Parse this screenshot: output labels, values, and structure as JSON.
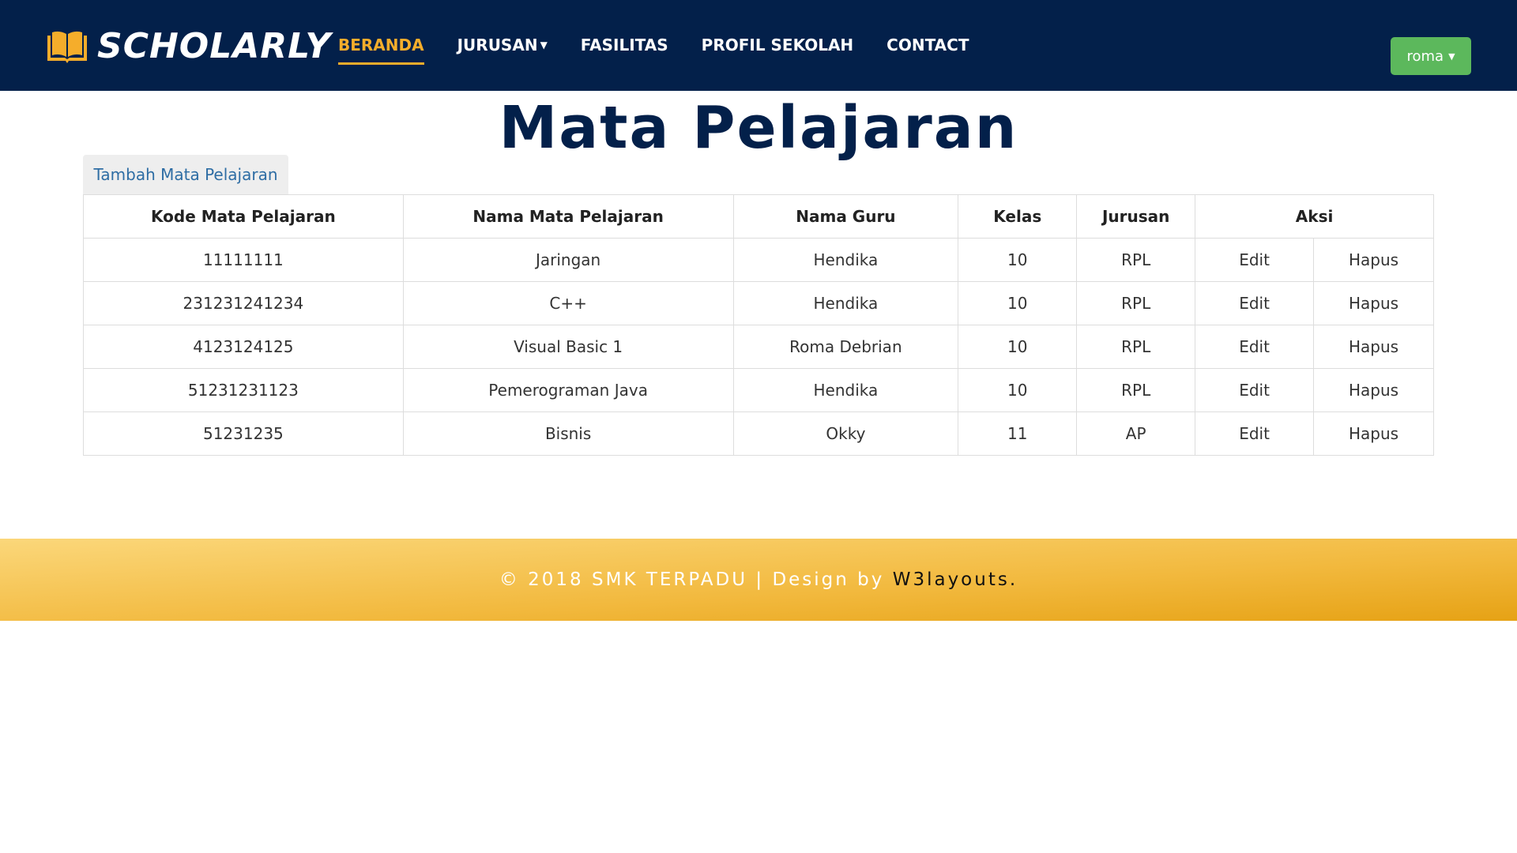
{
  "header": {
    "brand": "SCHOLARLY",
    "nav": [
      {
        "label": "BERANDA",
        "active": true,
        "dropdown": false
      },
      {
        "label": "JURUSAN",
        "active": false,
        "dropdown": true
      },
      {
        "label": "FASILITAS",
        "active": false,
        "dropdown": false
      },
      {
        "label": "PROFIL SEKOLAH",
        "active": false,
        "dropdown": false
      },
      {
        "label": "CONTACT",
        "active": false,
        "dropdown": false
      }
    ],
    "user": "roma"
  },
  "page": {
    "title": "Mata Pelajaran",
    "add_button": "Tambah Mata Pelajaran"
  },
  "table": {
    "headers": [
      "Kode Mata Pelajaran",
      "Nama Mata Pelajaran",
      "Nama Guru",
      "Kelas",
      "Jurusan",
      "Aksi"
    ],
    "rows": [
      {
        "kode": "11111111",
        "nama": "Jaringan",
        "guru": "Hendika",
        "kelas": "10",
        "jurusan": "RPL",
        "edit": "Edit",
        "hapus": "Hapus"
      },
      {
        "kode": "231231241234",
        "nama": "C++",
        "guru": "Hendika",
        "kelas": "10",
        "jurusan": "RPL",
        "edit": "Edit",
        "hapus": "Hapus"
      },
      {
        "kode": "4123124125",
        "nama": "Visual Basic 1",
        "guru": "Roma Debrian",
        "kelas": "10",
        "jurusan": "RPL",
        "edit": "Edit",
        "hapus": "Hapus"
      },
      {
        "kode": "51231231123",
        "nama": "Pemerograman Java",
        "guru": "Hendika",
        "kelas": "10",
        "jurusan": "RPL",
        "edit": "Edit",
        "hapus": "Hapus"
      },
      {
        "kode": "51231235",
        "nama": "Bisnis",
        "guru": "Okky",
        "kelas": "11",
        "jurusan": "AP",
        "edit": "Edit",
        "hapus": "Hapus"
      }
    ]
  },
  "footer": {
    "text": "© 2018 SMK TERPADU | Design by ",
    "link": "W3layouts."
  },
  "colors": {
    "navbar": "#03204a",
    "accent": "#f5ad2b",
    "user_button": "#5cb85c",
    "link": "#2e6da4"
  }
}
